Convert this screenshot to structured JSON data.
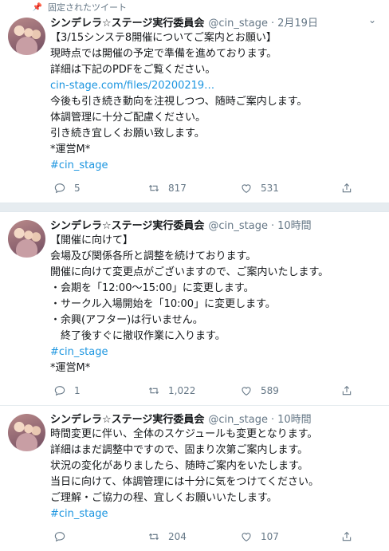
{
  "pinned_label": "固定されたツイート",
  "tweets": [
    {
      "name": "シンデレラ☆ステージ実行委員会",
      "handle": "@cin_stage",
      "dot": "·",
      "time": "2月19日",
      "lines": [
        "【3/15シンステ8開催についてご案内とお願い】",
        "現時点では開催の予定で準備を進めております。",
        "詳細は下記のPDFをご覧ください。",
        "cin-stage.com/files/20200219…",
        "今後も引き続き動向を注視しつつ、随時ご案内します。",
        "体調管理に十分ご配慮ください。",
        "引き続き宜しくお願い致します。",
        "*運営M*",
        "#cin_stage"
      ],
      "reply_count": "5",
      "retweet_count": "817",
      "like_count": "531"
    },
    {
      "name": "シンデレラ☆ステージ実行委員会",
      "handle": "@cin_stage",
      "dot": "·",
      "time": "10時間",
      "lines": [
        "【開催に向けて】",
        "会場及び関係各所と調整を続けております。",
        "開催に向けて変更点がございますので、ご案内いたします。",
        "・会期を「12:00～15:00」に変更します。",
        "・サークル入場開始を「10:00」に変更します。",
        "・余興(アフター)は行いません。",
        "　終了後すぐに撤収作業に入ります。",
        "#cin_stage",
        "*運営M*"
      ],
      "reply_count": "1",
      "retweet_count": "1,022",
      "like_count": "589"
    },
    {
      "name": "シンデレラ☆ステージ実行委員会",
      "handle": "@cin_stage",
      "dot": "·",
      "time": "10時間",
      "lines": [
        "時間変更に伴い、全体のスケジュールも変更となります。",
        "詳細はまだ調整中ですので、固まり次第ご案内します。",
        "状況の変化がありましたら、随時ご案内をいたします。",
        "当日に向けて、体調管理には十分に気をつけてください。",
        "ご理解・ご協力の程、宜しくお願いいたします。",
        "#cin_stage"
      ],
      "reply_count": "",
      "retweet_count": "204",
      "like_count": "107"
    }
  ],
  "icons": {
    "pin": "pin-icon",
    "reply": "reply-icon",
    "retweet": "retweet-icon",
    "like": "heart-icon",
    "share": "share-icon",
    "caret": "chevron-down-icon"
  },
  "colors": {
    "link": "#1b95e0",
    "meta": "#657786",
    "separator": "#e6ecf0"
  }
}
